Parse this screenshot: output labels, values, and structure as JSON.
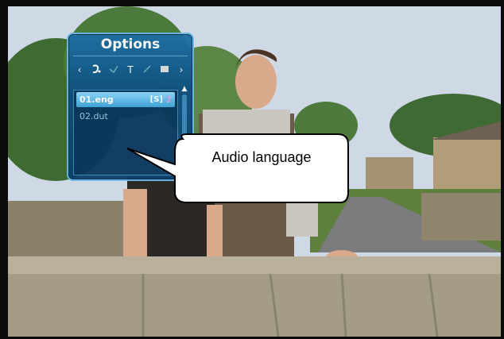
{
  "osd": {
    "title": "Options",
    "toolbar": {
      "left_arrow": "‹",
      "right_arrow": "›",
      "icons": [
        "audio-icon",
        "subtitle-text-icon",
        "teletext-icon"
      ],
      "text_icon_glyph": "T"
    },
    "tracks": [
      {
        "label": "01.eng",
        "tag": "[S]",
        "selected": true
      },
      {
        "label": "02.dut",
        "selected": false
      }
    ]
  },
  "callout": {
    "text": "Audio language"
  },
  "colors": {
    "osd_bg": "#0e4f80",
    "osd_border": "#69b8e6",
    "selection": "#3ea4dc"
  }
}
